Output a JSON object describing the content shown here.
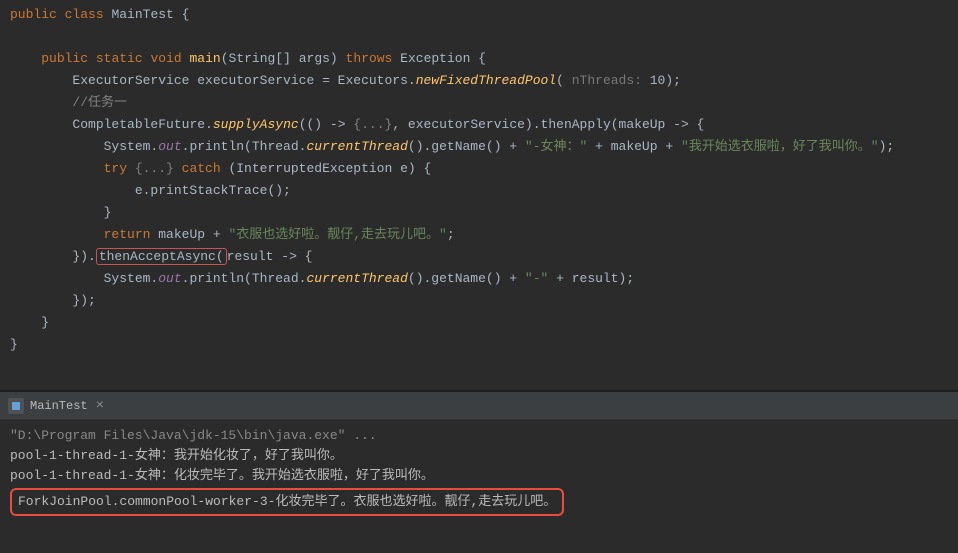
{
  "editor": {
    "l1": {
      "kw1": "public",
      "kw2": "class",
      "cls": "MainTest",
      "brace": " {"
    },
    "l2": "",
    "l3": {
      "kw1": "public",
      "kw2": "static",
      "kw3": "void",
      "method": "main",
      "p1": "(String[] args) ",
      "kw4": "throws",
      "exc": " Exception {"
    },
    "l4": {
      "p1": "ExecutorService executorService = Executors.",
      "method": "newFixedThreadPool",
      "p2": "( ",
      "hint": "nThreads: ",
      "p3": "10);"
    },
    "l5": {
      "comment": "//任务一"
    },
    "l6": {
      "p1": "CompletableFuture.",
      "method": "supplyAsync",
      "p2": "(() -> ",
      "fold": "{...}",
      "p3": ", executorService).thenApply(makeUp -> {"
    },
    "l7": {
      "p1": "System.",
      "field": "out",
      "p2": ".println(Thread.",
      "method": "currentThread",
      "p3": "().getName() + ",
      "str1": "\"-女神：\"",
      "p4": " + makeUp + ",
      "str2": "\"我开始选衣服啦，好了我叫你。\"",
      "p5": ");"
    },
    "l8": {
      "kw1": "try",
      "fold": " {...} ",
      "kw2": "catch",
      "p1": " (InterruptedException e) {"
    },
    "l9": {
      "p1": "e.printStackTrace();"
    },
    "l10": {
      "p1": "}"
    },
    "l11": {
      "kw1": "return",
      "p1": " makeUp + ",
      "str": "\"衣服也选好啦。靓仔,走去玩儿吧。\"",
      "p2": ";"
    },
    "l12": {
      "p1": "}).",
      "boxed": "thenAcceptAsync(",
      "p2": "result -> {"
    },
    "l13": {
      "p1": "System.",
      "field": "out",
      "p2": ".println(Thread.",
      "method": "currentThread",
      "p3": "().getName() + ",
      "str": "\"-\"",
      "p4": " + result);"
    },
    "l14": {
      "p1": "});"
    },
    "l15": {
      "p1": "}"
    },
    "l16": {
      "p1": "}"
    }
  },
  "console": {
    "tab": "MainTest",
    "line1": "\"D:\\Program Files\\Java\\jdk-15\\bin\\java.exe\" ...",
    "line2": "pool-1-thread-1-女神：我开始化妆了，好了我叫你。",
    "line3": "pool-1-thread-1-女神：化妆完毕了。我开始选衣服啦，好了我叫你。",
    "line4": "ForkJoinPool.commonPool-worker-3-化妆完毕了。衣服也选好啦。靓仔,走去玩儿吧。"
  }
}
